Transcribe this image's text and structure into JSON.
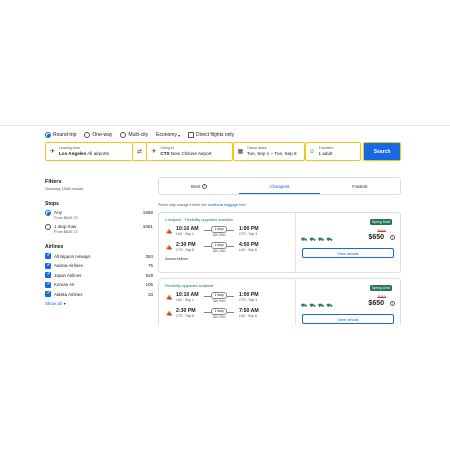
{
  "trip_type": {
    "options": [
      "Round-trip",
      "One-way",
      "Multi-city"
    ],
    "selected": "Round-trip"
  },
  "cabin_class": "Economy",
  "direct_only": {
    "label": "Direct flights only",
    "checked": false
  },
  "search": {
    "leaving": {
      "label": "Leaving from",
      "city": "Los Angeles",
      "detail": "All airports"
    },
    "going": {
      "label": "Going to",
      "code": "CTS",
      "detail": "New Chitose Airport"
    },
    "dates": {
      "label": "Travel dates",
      "value": "Tue, Sep 1 – Tue, Sep 8"
    },
    "travelers": {
      "label": "Travelers",
      "value": "1 adult"
    },
    "button": "Search"
  },
  "filters": {
    "title": "Filters",
    "showing": "Showing 1558 results",
    "stops_title": "Stops",
    "stops": [
      {
        "label": "Any",
        "from": "From $649.72",
        "count": "1558",
        "selected": true
      },
      {
        "label": "1 stop max",
        "from": "From $649.72",
        "count": "1061",
        "selected": false
      }
    ],
    "airlines_title": "Airlines",
    "airlines": [
      {
        "name": "All Nippon Airways",
        "count": "384"
      },
      {
        "name": "Asiana Airlines",
        "count": "75"
      },
      {
        "name": "Japan Airlines",
        "count": "529"
      },
      {
        "name": "Korean Air",
        "count": "106"
      },
      {
        "name": "Alaska Airlines",
        "count": "33"
      }
    ],
    "show_all": "Show all"
  },
  "sort": {
    "tabs": [
      "Best",
      "Cheapest",
      "Fastest"
    ],
    "active": "Cheapest"
  },
  "notice": {
    "text": "Prices may change if there are",
    "link": "additional baggage fees"
  },
  "results": [
    {
      "badge": "Cheapest · Flexibility upgrades available",
      "segments": [
        {
          "dep_time": "10:10 AM",
          "dep_ap": "LAX · Sep 1",
          "stops": "1 stop",
          "duration": "34h 50m",
          "arr_time": "1:00 PM",
          "arr_ap": "CTS · Sep 3"
        },
        {
          "dep_time": "2:30 PM",
          "dep_ap": "CTS · Sep 8",
          "stops": "1 stop",
          "duration": "18h 20m",
          "arr_time": "4:50 PM",
          "arr_ap": "LAX · Sep 8"
        }
      ],
      "carrier": "Asiana Airlines",
      "deal": "Spring Deal",
      "old_price": "$660",
      "price": "$650",
      "cta": "View details"
    },
    {
      "badge": "Flexibility upgrades available",
      "segments": [
        {
          "dep_time": "10:10 AM",
          "dep_ap": "LAX · Sep 1",
          "stops": "1 stop",
          "duration": "34h 50m",
          "arr_time": "1:00 PM",
          "arr_ap": "CTS · Sep 3"
        },
        {
          "dep_time": "2:30 PM",
          "dep_ap": "CTS · Sep 8",
          "stops": "1 stop",
          "duration": "32h 20m",
          "arr_time": "7:50 AM",
          "arr_ap": "LAX · Sep 8"
        }
      ],
      "carrier": "",
      "deal": "Spring Deal",
      "old_price": "$660",
      "price": "$650",
      "cta": "View details"
    }
  ],
  "colors": {
    "accent": "#1668e3",
    "highlight": "#f5c518",
    "deal": "#227950"
  }
}
